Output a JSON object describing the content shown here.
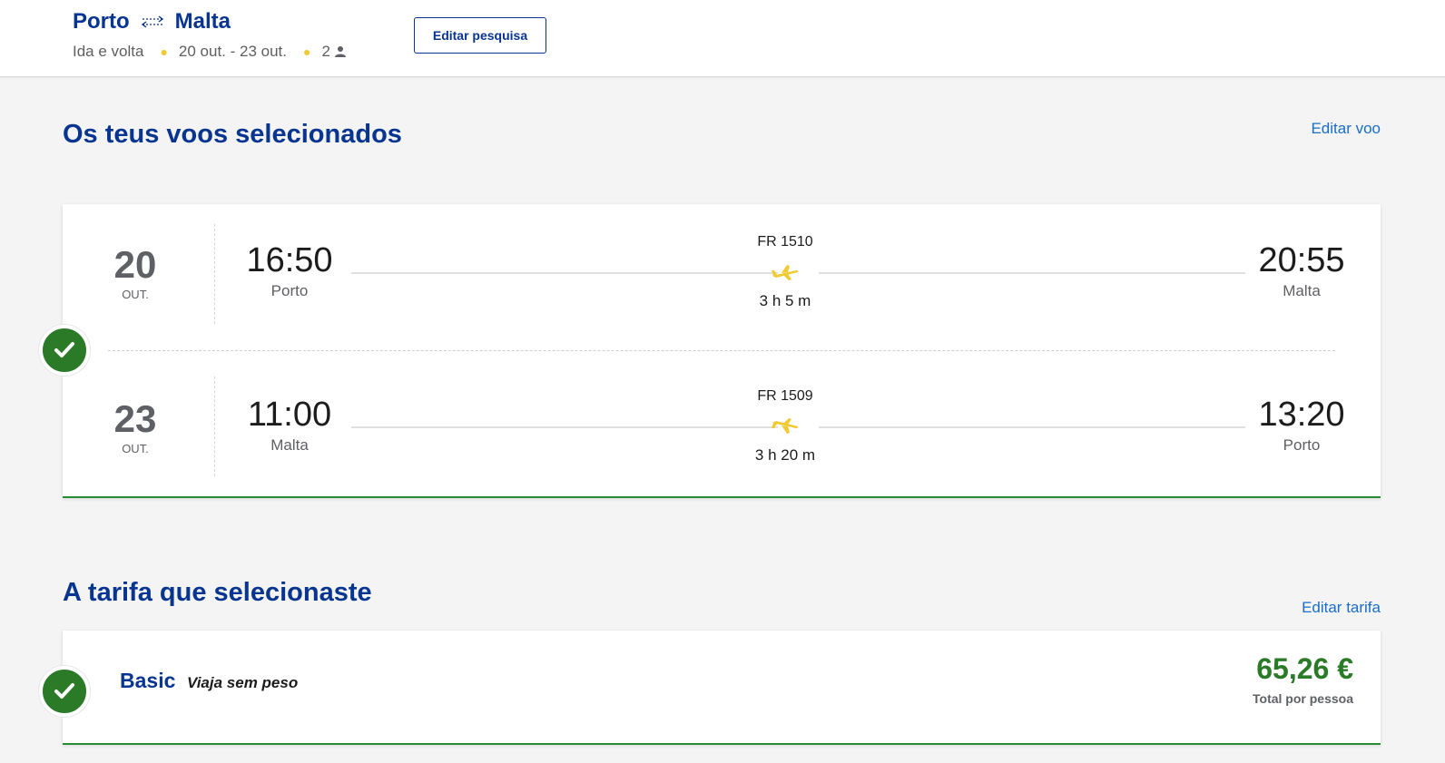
{
  "header": {
    "origin": "Porto",
    "destination": "Malta",
    "trip_type": "Ida e volta",
    "dates": "20 out. - 23 out.",
    "passengers": "2",
    "edit_search_label": "Editar pesquisa"
  },
  "flights_section": {
    "title": "Os teus voos selecionados",
    "edit_label": "Editar voo",
    "flights": [
      {
        "day": "20",
        "month": "OUT.",
        "dep_time": "16:50",
        "dep_city": "Porto",
        "flight_no": "FR 1510",
        "duration": "3 h 5 m",
        "arr_time": "20:55",
        "arr_city": "Malta"
      },
      {
        "day": "23",
        "month": "OUT.",
        "dep_time": "11:00",
        "dep_city": "Malta",
        "flight_no": "FR 1509",
        "duration": "3 h 20 m",
        "arr_time": "13:20",
        "arr_city": "Porto"
      }
    ]
  },
  "fare_section": {
    "title": "A tarifa que selecionaste",
    "edit_label": "Editar tarifa",
    "fare_name": "Basic",
    "fare_description": "Viaja sem peso",
    "price": "65,26 €",
    "price_note": "Total por pessoa"
  },
  "colors": {
    "brand_blue": "#073590",
    "link_blue": "#1a6dc8",
    "success_green": "#2a7a28",
    "accent_yellow": "#f1c931"
  },
  "icons": {
    "swap": "swap-arrows-icon",
    "person": "person-icon",
    "plane": "plane-icon",
    "check": "check-icon"
  }
}
